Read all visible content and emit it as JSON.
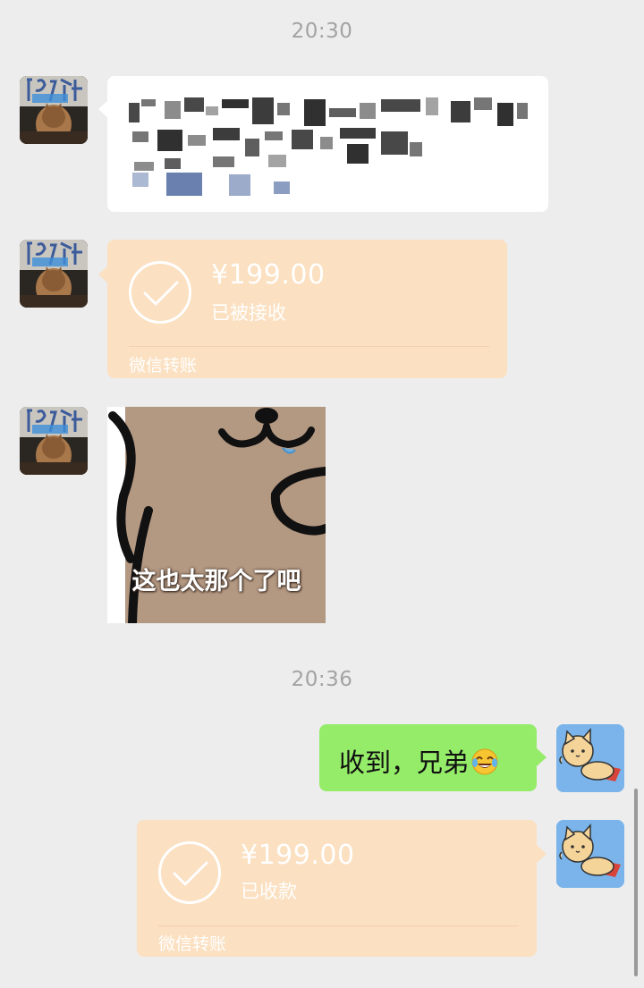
{
  "chat": {
    "timestamps": [
      "20:30",
      "20:36"
    ],
    "transfer_received": {
      "amount": "¥199.00",
      "status": "已被接收",
      "brand": "微信转账"
    },
    "sticker": {
      "caption": "这也太那个了吧"
    },
    "my_message": {
      "text": "收到，兄弟",
      "emoji": "face-with-tears-of-joy"
    },
    "transfer_collected": {
      "amount": "¥199.00",
      "status": "已收款",
      "brand": "微信转账"
    }
  },
  "colors": {
    "background": "#ededed",
    "transfer_bubble": "#fbe0c1",
    "my_bubble": "#95ec69",
    "their_bubble": "#ffffff"
  }
}
